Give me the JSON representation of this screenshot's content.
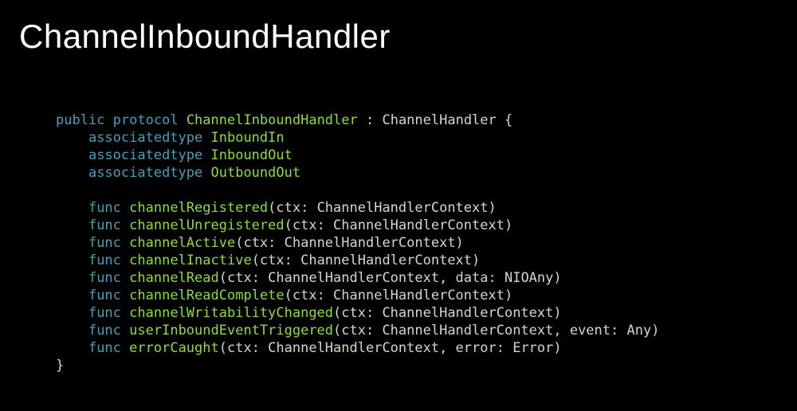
{
  "title": "ChannelInboundHandler",
  "code": {
    "kw_public": "public",
    "kw_protocol": "protocol",
    "protocol_name": "ChannelInboundHandler",
    "colon": " : ",
    "super": "ChannelHandler",
    "brace_open": " {",
    "kw_assoc1": "associatedtype",
    "assoc1": "InboundIn",
    "kw_assoc2": "associatedtype",
    "assoc2": "InboundOut",
    "kw_assoc3": "associatedtype",
    "assoc3": "OutboundOut",
    "kw_func1": "func",
    "fn1": "channelRegistered",
    "sig1": "(ctx: ChannelHandlerContext)",
    "kw_func2": "func",
    "fn2": "channelUnregistered",
    "sig2": "(ctx: ChannelHandlerContext)",
    "kw_func3": "func",
    "fn3": "channelActive",
    "sig3": "(ctx: ChannelHandlerContext)",
    "kw_func4": "func",
    "fn4": "channelInactive",
    "sig4": "(ctx: ChannelHandlerContext)",
    "kw_func5": "func",
    "fn5": "channelRead",
    "sig5": "(ctx: ChannelHandlerContext, data: NIOAny)",
    "kw_func6": "func",
    "fn6": "channelReadComplete",
    "sig6": "(ctx: ChannelHandlerContext)",
    "kw_func7": "func",
    "fn7": "channelWritabilityChanged",
    "sig7": "(ctx: ChannelHandlerContext)",
    "kw_func8": "func",
    "fn8": "userInboundEventTriggered",
    "sig8": "(ctx: ChannelHandlerContext, event: Any)",
    "kw_func9": "func",
    "fn9": "errorCaught",
    "sig9": "(ctx: ChannelHandlerContext, error: Error)",
    "brace_close": "}"
  }
}
